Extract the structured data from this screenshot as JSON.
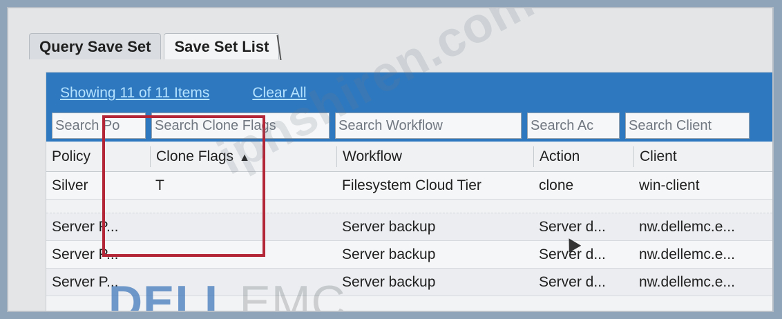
{
  "tabs": [
    {
      "label": "Query Save Set"
    },
    {
      "label": "Save Set List"
    }
  ],
  "summary": {
    "showing": "Showing  11 of 11 Items",
    "clear_all": "Clear All"
  },
  "search": {
    "policy": "Search Po",
    "clone_flags": "Search Clone Flags",
    "workflow": "Search Workflow",
    "action": "Search Ac",
    "client": "Search Client"
  },
  "table": {
    "headers": {
      "policy": "Policy",
      "clone_flags": "Clone Flags",
      "workflow": "Workflow",
      "action": "Action",
      "client": "Client"
    },
    "rows": [
      {
        "policy": "Silver",
        "clone_flags": "T",
        "workflow": "Filesystem Cloud Tier",
        "action": "clone",
        "client": "win-client"
      },
      {
        "policy": "Server P...",
        "clone_flags": "",
        "workflow": "Server backup",
        "action": "Server d...",
        "client": "nw.dellemc.e..."
      },
      {
        "policy": "Server P...",
        "clone_flags": "",
        "workflow": "Server backup",
        "action": "Server d...",
        "client": "nw.dellemc.e..."
      },
      {
        "policy": "Server P...",
        "clone_flags": "",
        "workflow": "Server backup",
        "action": "Server d...",
        "client": "nw.dellemc.e..."
      }
    ]
  },
  "watermark": {
    "site": "ipnshiren.com",
    "logo_dell": "DELL",
    "logo_emc": "EMC"
  },
  "colors": {
    "toolbar_blue": "#2e78bf",
    "link_blue": "#b5e3ff",
    "highlight_red": "#b32637"
  }
}
